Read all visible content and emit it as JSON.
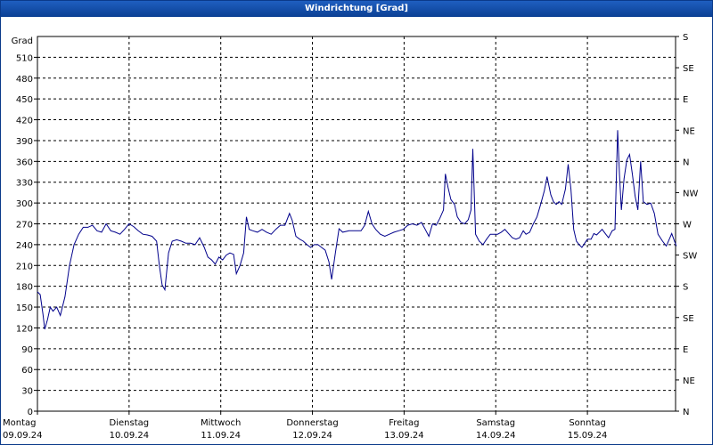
{
  "window": {
    "title": "Windrichtung [Grad]"
  },
  "chart_data": {
    "type": "line",
    "title": "Windrichtung [Grad]",
    "ylabel": "Grad",
    "ylim": [
      0,
      540
    ],
    "yticks": [
      0,
      30,
      60,
      90,
      120,
      150,
      180,
      210,
      240,
      270,
      300,
      330,
      360,
      390,
      420,
      450,
      480,
      510
    ],
    "right_ticks": [
      {
        "value": 0,
        "label": "N"
      },
      {
        "value": 45,
        "label": "NE"
      },
      {
        "value": 90,
        "label": "E"
      },
      {
        "value": 135,
        "label": "SE"
      },
      {
        "value": 180,
        "label": "S"
      },
      {
        "value": 225,
        "label": "SW"
      },
      {
        "value": 270,
        "label": "W"
      },
      {
        "value": 315,
        "label": "NW"
      },
      {
        "value": 360,
        "label": "N"
      },
      {
        "value": 405,
        "label": "NE"
      },
      {
        "value": 450,
        "label": "E"
      },
      {
        "value": 495,
        "label": "SE"
      },
      {
        "value": 540,
        "label": "S"
      }
    ],
    "x_range_days": [
      0,
      7
    ],
    "days": [
      {
        "day": "Montag",
        "date": "09.09.24"
      },
      {
        "day": "Dienstag",
        "date": "10.09.24"
      },
      {
        "day": "Mittwoch",
        "date": "11.09.24"
      },
      {
        "day": "Donnerstag",
        "date": "12.09.24"
      },
      {
        "day": "Freitag",
        "date": "13.09.24"
      },
      {
        "day": "Samstag",
        "date": "14.09.24"
      },
      {
        "day": "Sonntag",
        "date": "15.09.24"
      }
    ],
    "grid": true,
    "line_color": "#00008b",
    "series": [
      {
        "points": [
          [
            0.0,
            172
          ],
          [
            0.03,
            168
          ],
          [
            0.06,
            140
          ],
          [
            0.08,
            118
          ],
          [
            0.11,
            132
          ],
          [
            0.14,
            150
          ],
          [
            0.17,
            144
          ],
          [
            0.21,
            150
          ],
          [
            0.25,
            138
          ],
          [
            0.3,
            165
          ],
          [
            0.35,
            210
          ],
          [
            0.4,
            240
          ],
          [
            0.45,
            255
          ],
          [
            0.5,
            265
          ],
          [
            0.55,
            265
          ],
          [
            0.6,
            268
          ],
          [
            0.65,
            260
          ],
          [
            0.7,
            258
          ],
          [
            0.75,
            270
          ],
          [
            0.8,
            260
          ],
          [
            0.85,
            258
          ],
          [
            0.9,
            255
          ],
          [
            0.95,
            262
          ],
          [
            1.0,
            270
          ],
          [
            1.05,
            266
          ],
          [
            1.1,
            260
          ],
          [
            1.15,
            255
          ],
          [
            1.2,
            254
          ],
          [
            1.25,
            252
          ],
          [
            1.3,
            245
          ],
          [
            1.33,
            210
          ],
          [
            1.36,
            182
          ],
          [
            1.39,
            175
          ],
          [
            1.43,
            228
          ],
          [
            1.47,
            245
          ],
          [
            1.52,
            247
          ],
          [
            1.57,
            245
          ],
          [
            1.62,
            242
          ],
          [
            1.67,
            242
          ],
          [
            1.72,
            240
          ],
          [
            1.77,
            250
          ],
          [
            1.82,
            236
          ],
          [
            1.86,
            222
          ],
          [
            1.9,
            218
          ],
          [
            1.94,
            212
          ],
          [
            1.98,
            222
          ],
          [
            2.02,
            218
          ],
          [
            2.06,
            225
          ],
          [
            2.1,
            228
          ],
          [
            2.14,
            226
          ],
          [
            2.17,
            198
          ],
          [
            2.21,
            210
          ],
          [
            2.25,
            228
          ],
          [
            2.28,
            280
          ],
          [
            2.31,
            262
          ],
          [
            2.35,
            260
          ],
          [
            2.4,
            258
          ],
          [
            2.45,
            262
          ],
          [
            2.5,
            258
          ],
          [
            2.55,
            255
          ],
          [
            2.6,
            262
          ],
          [
            2.65,
            268
          ],
          [
            2.7,
            268
          ],
          [
            2.75,
            285
          ],
          [
            2.78,
            275
          ],
          [
            2.82,
            252
          ],
          [
            2.86,
            248
          ],
          [
            2.9,
            245
          ],
          [
            2.94,
            240
          ],
          [
            2.98,
            236
          ],
          [
            3.02,
            240
          ],
          [
            3.06,
            240
          ],
          [
            3.1,
            236
          ],
          [
            3.14,
            232
          ],
          [
            3.18,
            215
          ],
          [
            3.21,
            190
          ],
          [
            3.25,
            228
          ],
          [
            3.29,
            263
          ],
          [
            3.33,
            258
          ],
          [
            3.4,
            260
          ],
          [
            3.47,
            260
          ],
          [
            3.53,
            260
          ],
          [
            3.57,
            268
          ],
          [
            3.61,
            288
          ],
          [
            3.65,
            270
          ],
          [
            3.69,
            262
          ],
          [
            3.74,
            255
          ],
          [
            3.79,
            252
          ],
          [
            3.84,
            255
          ],
          [
            3.89,
            258
          ],
          [
            3.94,
            260
          ],
          [
            3.99,
            262
          ],
          [
            4.04,
            268
          ],
          [
            4.09,
            270
          ],
          [
            4.14,
            268
          ],
          [
            4.19,
            272
          ],
          [
            4.23,
            262
          ],
          [
            4.27,
            252
          ],
          [
            4.31,
            270
          ],
          [
            4.35,
            268
          ],
          [
            4.39,
            278
          ],
          [
            4.43,
            290
          ],
          [
            4.45,
            342
          ],
          [
            4.48,
            322
          ],
          [
            4.51,
            305
          ],
          [
            4.55,
            298
          ],
          [
            4.58,
            280
          ],
          [
            4.62,
            272
          ],
          [
            4.66,
            270
          ],
          [
            4.7,
            276
          ],
          [
            4.73,
            290
          ],
          [
            4.75,
            378
          ],
          [
            4.78,
            255
          ],
          [
            4.82,
            245
          ],
          [
            4.86,
            240
          ],
          [
            4.9,
            248
          ],
          [
            4.94,
            255
          ],
          [
            4.98,
            255
          ],
          [
            5.02,
            255
          ],
          [
            5.06,
            258
          ],
          [
            5.1,
            262
          ],
          [
            5.14,
            256
          ],
          [
            5.18,
            250
          ],
          [
            5.22,
            248
          ],
          [
            5.26,
            250
          ],
          [
            5.3,
            260
          ],
          [
            5.33,
            255
          ],
          [
            5.37,
            258
          ],
          [
            5.41,
            270
          ],
          [
            5.45,
            280
          ],
          [
            5.49,
            298
          ],
          [
            5.53,
            318
          ],
          [
            5.56,
            338
          ],
          [
            5.6,
            312
          ],
          [
            5.63,
            302
          ],
          [
            5.66,
            298
          ],
          [
            5.69,
            302
          ],
          [
            5.72,
            298
          ],
          [
            5.76,
            320
          ],
          [
            5.79,
            356
          ],
          [
            5.82,
            320
          ],
          [
            5.85,
            262
          ],
          [
            5.88,
            245
          ],
          [
            5.91,
            240
          ],
          [
            5.94,
            236
          ],
          [
            5.97,
            242
          ],
          [
            6.0,
            248
          ],
          [
            6.04,
            248
          ],
          [
            6.07,
            256
          ],
          [
            6.1,
            254
          ],
          [
            6.13,
            258
          ],
          [
            6.16,
            262
          ],
          [
            6.2,
            255
          ],
          [
            6.23,
            250
          ],
          [
            6.27,
            260
          ],
          [
            6.3,
            262
          ],
          [
            6.33,
            405
          ],
          [
            6.35,
            340
          ],
          [
            6.37,
            290
          ],
          [
            6.4,
            335
          ],
          [
            6.43,
            362
          ],
          [
            6.46,
            370
          ],
          [
            6.49,
            342
          ],
          [
            6.52,
            310
          ],
          [
            6.55,
            290
          ],
          [
            6.58,
            360
          ],
          [
            6.61,
            302
          ],
          [
            6.65,
            298
          ],
          [
            6.69,
            300
          ],
          [
            6.73,
            285
          ],
          [
            6.77,
            255
          ],
          [
            6.82,
            245
          ],
          [
            6.86,
            238
          ],
          [
            6.9,
            250
          ],
          [
            6.92,
            256
          ],
          [
            6.95,
            245
          ],
          [
            6.97,
            238
          ]
        ]
      }
    ]
  }
}
